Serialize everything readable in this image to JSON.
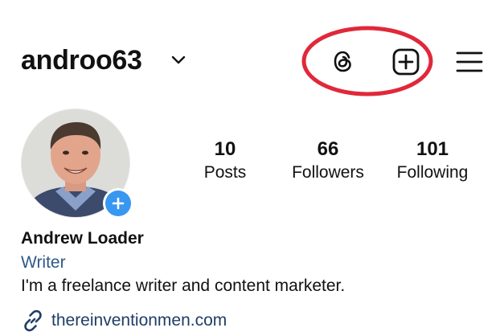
{
  "header": {
    "username": "androo63",
    "icons": [
      "chevron-down-icon",
      "threads-icon",
      "create-post-icon",
      "menu-icon"
    ],
    "annotation_color": "#e0283a"
  },
  "profile": {
    "stats": [
      {
        "value": "10",
        "label": "Posts"
      },
      {
        "value": "66",
        "label": "Followers"
      },
      {
        "value": "101",
        "label": "Following"
      }
    ],
    "name": "Andrew Loader",
    "category": "Writer",
    "bio": "I'm a freelance writer and content marketer.",
    "link": "thereinventionmen.com",
    "badge_color": "#3897f0",
    "category_color": "#2d5a88"
  }
}
